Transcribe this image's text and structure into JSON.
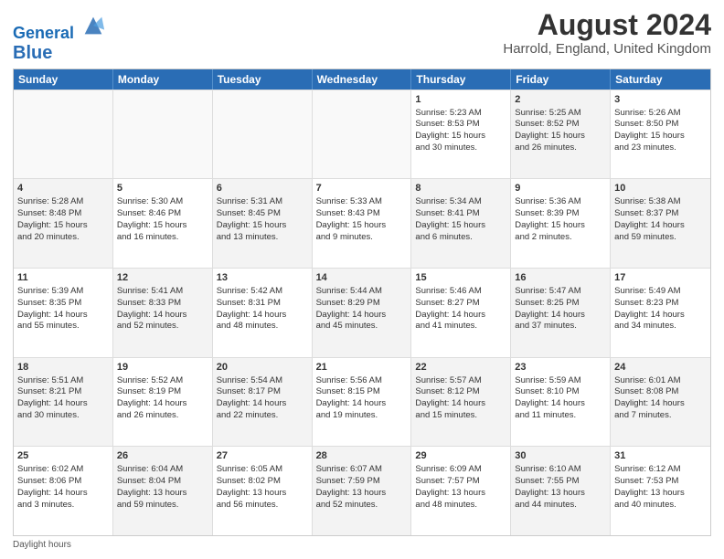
{
  "header": {
    "logo_line1": "General",
    "logo_line2": "Blue",
    "main_title": "August 2024",
    "sub_title": "Harrold, England, United Kingdom"
  },
  "weekdays": [
    "Sunday",
    "Monday",
    "Tuesday",
    "Wednesday",
    "Thursday",
    "Friday",
    "Saturday"
  ],
  "rows": [
    [
      {
        "day": "",
        "info": "",
        "bg": "empty"
      },
      {
        "day": "",
        "info": "",
        "bg": "empty"
      },
      {
        "day": "",
        "info": "",
        "bg": "empty"
      },
      {
        "day": "",
        "info": "",
        "bg": "empty"
      },
      {
        "day": "1",
        "info": "Sunrise: 5:23 AM\nSunset: 8:53 PM\nDaylight: 15 hours\nand 30 minutes.",
        "bg": ""
      },
      {
        "day": "2",
        "info": "Sunrise: 5:25 AM\nSunset: 8:52 PM\nDaylight: 15 hours\nand 26 minutes.",
        "bg": "alt"
      },
      {
        "day": "3",
        "info": "Sunrise: 5:26 AM\nSunset: 8:50 PM\nDaylight: 15 hours\nand 23 minutes.",
        "bg": ""
      }
    ],
    [
      {
        "day": "4",
        "info": "Sunrise: 5:28 AM\nSunset: 8:48 PM\nDaylight: 15 hours\nand 20 minutes.",
        "bg": "alt"
      },
      {
        "day": "5",
        "info": "Sunrise: 5:30 AM\nSunset: 8:46 PM\nDaylight: 15 hours\nand 16 minutes.",
        "bg": ""
      },
      {
        "day": "6",
        "info": "Sunrise: 5:31 AM\nSunset: 8:45 PM\nDaylight: 15 hours\nand 13 minutes.",
        "bg": "alt"
      },
      {
        "day": "7",
        "info": "Sunrise: 5:33 AM\nSunset: 8:43 PM\nDaylight: 15 hours\nand 9 minutes.",
        "bg": ""
      },
      {
        "day": "8",
        "info": "Sunrise: 5:34 AM\nSunset: 8:41 PM\nDaylight: 15 hours\nand 6 minutes.",
        "bg": "alt"
      },
      {
        "day": "9",
        "info": "Sunrise: 5:36 AM\nSunset: 8:39 PM\nDaylight: 15 hours\nand 2 minutes.",
        "bg": ""
      },
      {
        "day": "10",
        "info": "Sunrise: 5:38 AM\nSunset: 8:37 PM\nDaylight: 14 hours\nand 59 minutes.",
        "bg": "alt"
      }
    ],
    [
      {
        "day": "11",
        "info": "Sunrise: 5:39 AM\nSunset: 8:35 PM\nDaylight: 14 hours\nand 55 minutes.",
        "bg": ""
      },
      {
        "day": "12",
        "info": "Sunrise: 5:41 AM\nSunset: 8:33 PM\nDaylight: 14 hours\nand 52 minutes.",
        "bg": "alt"
      },
      {
        "day": "13",
        "info": "Sunrise: 5:42 AM\nSunset: 8:31 PM\nDaylight: 14 hours\nand 48 minutes.",
        "bg": ""
      },
      {
        "day": "14",
        "info": "Sunrise: 5:44 AM\nSunset: 8:29 PM\nDaylight: 14 hours\nand 45 minutes.",
        "bg": "alt"
      },
      {
        "day": "15",
        "info": "Sunrise: 5:46 AM\nSunset: 8:27 PM\nDaylight: 14 hours\nand 41 minutes.",
        "bg": ""
      },
      {
        "day": "16",
        "info": "Sunrise: 5:47 AM\nSunset: 8:25 PM\nDaylight: 14 hours\nand 37 minutes.",
        "bg": "alt"
      },
      {
        "day": "17",
        "info": "Sunrise: 5:49 AM\nSunset: 8:23 PM\nDaylight: 14 hours\nand 34 minutes.",
        "bg": ""
      }
    ],
    [
      {
        "day": "18",
        "info": "Sunrise: 5:51 AM\nSunset: 8:21 PM\nDaylight: 14 hours\nand 30 minutes.",
        "bg": "alt"
      },
      {
        "day": "19",
        "info": "Sunrise: 5:52 AM\nSunset: 8:19 PM\nDaylight: 14 hours\nand 26 minutes.",
        "bg": ""
      },
      {
        "day": "20",
        "info": "Sunrise: 5:54 AM\nSunset: 8:17 PM\nDaylight: 14 hours\nand 22 minutes.",
        "bg": "alt"
      },
      {
        "day": "21",
        "info": "Sunrise: 5:56 AM\nSunset: 8:15 PM\nDaylight: 14 hours\nand 19 minutes.",
        "bg": ""
      },
      {
        "day": "22",
        "info": "Sunrise: 5:57 AM\nSunset: 8:12 PM\nDaylight: 14 hours\nand 15 minutes.",
        "bg": "alt"
      },
      {
        "day": "23",
        "info": "Sunrise: 5:59 AM\nSunset: 8:10 PM\nDaylight: 14 hours\nand 11 minutes.",
        "bg": ""
      },
      {
        "day": "24",
        "info": "Sunrise: 6:01 AM\nSunset: 8:08 PM\nDaylight: 14 hours\nand 7 minutes.",
        "bg": "alt"
      }
    ],
    [
      {
        "day": "25",
        "info": "Sunrise: 6:02 AM\nSunset: 8:06 PM\nDaylight: 14 hours\nand 3 minutes.",
        "bg": ""
      },
      {
        "day": "26",
        "info": "Sunrise: 6:04 AM\nSunset: 8:04 PM\nDaylight: 13 hours\nand 59 minutes.",
        "bg": "alt"
      },
      {
        "day": "27",
        "info": "Sunrise: 6:05 AM\nSunset: 8:02 PM\nDaylight: 13 hours\nand 56 minutes.",
        "bg": ""
      },
      {
        "day": "28",
        "info": "Sunrise: 6:07 AM\nSunset: 7:59 PM\nDaylight: 13 hours\nand 52 minutes.",
        "bg": "alt"
      },
      {
        "day": "29",
        "info": "Sunrise: 6:09 AM\nSunset: 7:57 PM\nDaylight: 13 hours\nand 48 minutes.",
        "bg": ""
      },
      {
        "day": "30",
        "info": "Sunrise: 6:10 AM\nSunset: 7:55 PM\nDaylight: 13 hours\nand 44 minutes.",
        "bg": "alt"
      },
      {
        "day": "31",
        "info": "Sunrise: 6:12 AM\nSunset: 7:53 PM\nDaylight: 13 hours\nand 40 minutes.",
        "bg": ""
      }
    ]
  ],
  "footer": {
    "note": "Daylight hours"
  }
}
